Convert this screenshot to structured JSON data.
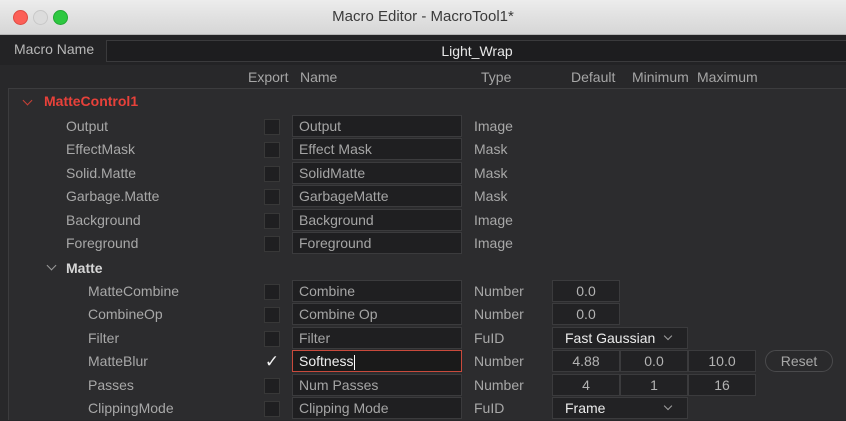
{
  "window": {
    "title": "Macro Editor - MacroTool1*"
  },
  "macro_name": {
    "label": "Macro Name",
    "value": "Light_Wrap"
  },
  "columns": {
    "export": "Export",
    "name": "Name",
    "type": "Type",
    "default": "Default",
    "minimum": "Minimum",
    "maximum": "Maximum"
  },
  "groups": {
    "matte_control": "MatteControl1",
    "matte": "Matte"
  },
  "inputs": [
    {
      "label": "Output",
      "name": "Output",
      "type": "Image"
    },
    {
      "label": "EffectMask",
      "name": "Effect Mask",
      "type": "Mask"
    },
    {
      "label": "Solid.Matte",
      "name": "SolidMatte",
      "type": "Mask"
    },
    {
      "label": "Garbage.Matte",
      "name": "GarbageMatte",
      "type": "Mask"
    },
    {
      "label": "Background",
      "name": "Background",
      "type": "Image"
    },
    {
      "label": "Foreground",
      "name": "Foreground",
      "type": "Image"
    }
  ],
  "matte_rows": [
    {
      "label": "MatteCombine",
      "name": "Combine",
      "type": "Number",
      "default": "0.0"
    },
    {
      "label": "CombineOp",
      "name": "Combine Op",
      "type": "Number",
      "default": "0.0"
    },
    {
      "label": "Filter",
      "name": "Filter",
      "type": "FuID",
      "default": "Fast Gaussian"
    },
    {
      "label": "MatteBlur",
      "name": "Softness",
      "type": "Number",
      "default": "4.88",
      "minimum": "0.0",
      "maximum": "10.0",
      "export_checked": true
    },
    {
      "label": "Passes",
      "name": "Num Passes",
      "type": "Number",
      "default": "4",
      "minimum": "1",
      "maximum": "16"
    },
    {
      "label": "ClippingMode",
      "name": "Clipping Mode",
      "type": "FuID",
      "default": "Frame"
    }
  ],
  "reset_label": "Reset",
  "check_mark": "✓",
  "colors": {
    "accent_red": "#e8413a",
    "close": "#fc5f57",
    "minimize": "#d9d9d9",
    "zoom": "#2dc840"
  }
}
